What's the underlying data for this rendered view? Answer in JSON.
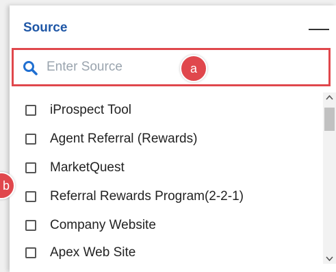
{
  "filter": {
    "title": "Source",
    "search": {
      "placeholder": "Enter Source",
      "value": ""
    },
    "items": [
      {
        "label": "iProspect Tool",
        "checked": false
      },
      {
        "label": "Agent Referral (Rewards)",
        "checked": false
      },
      {
        "label": "MarketQuest",
        "checked": false
      },
      {
        "label": "Referral Rewards Program(2-2-1)",
        "checked": false
      },
      {
        "label": "Company Website",
        "checked": false
      },
      {
        "label": "Apex Web Site",
        "checked": false
      }
    ]
  },
  "callouts": {
    "a": "a",
    "b": "b"
  },
  "icons": {
    "search": "search-icon",
    "collapse": "minus-icon",
    "scroll_up": "chevron-up-icon",
    "scroll_down": "chevron-down-icon"
  },
  "colors": {
    "accent": "#1f57a6",
    "highlight": "#e0474c",
    "search_icon": "#1f6fd1"
  }
}
